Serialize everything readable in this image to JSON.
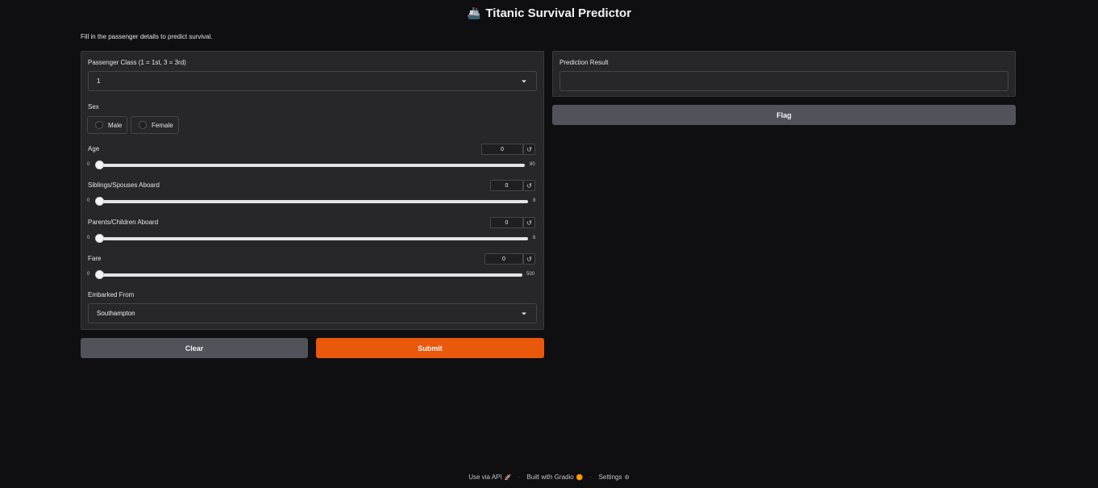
{
  "header": {
    "title": "Titanic Survival Predictor",
    "title_icon": "ship-icon",
    "description": "Fill in the passenger details to predict survival."
  },
  "form": {
    "pclass": {
      "label": "Passenger Class (1 = 1st, 3 = 3rd)",
      "value": "1"
    },
    "sex": {
      "label": "Sex",
      "options": [
        "Male",
        "Female"
      ],
      "selected": null
    },
    "age": {
      "label": "Age",
      "value": "0",
      "min": "0",
      "max": "80",
      "level": 0
    },
    "sibsp": {
      "label": "Siblings/Spouses Aboard",
      "value": "0",
      "min": "0",
      "max": "8",
      "level": 0
    },
    "parch": {
      "label": "Parents/Children Aboard",
      "value": "0",
      "min": "0",
      "max": "6",
      "level": 0
    },
    "fare": {
      "label": "Fare",
      "value": "0",
      "min": "0",
      "max": "500",
      "level": 0
    },
    "embarked": {
      "label": "Embarked From",
      "value": "Southampton"
    },
    "reset_icon": "↺"
  },
  "actions": {
    "clear": "Clear",
    "submit": "Submit"
  },
  "output": {
    "label": "Prediction Result",
    "value": "",
    "flag": "Flag"
  },
  "footer": {
    "api": "Use via API",
    "built": "Built with Gradio",
    "settings": "Settings",
    "separator": "·"
  },
  "colors": {
    "background": "#0f0f11",
    "panel": "#27272a",
    "primary": "#ea580c",
    "secondary": "#52525b"
  }
}
